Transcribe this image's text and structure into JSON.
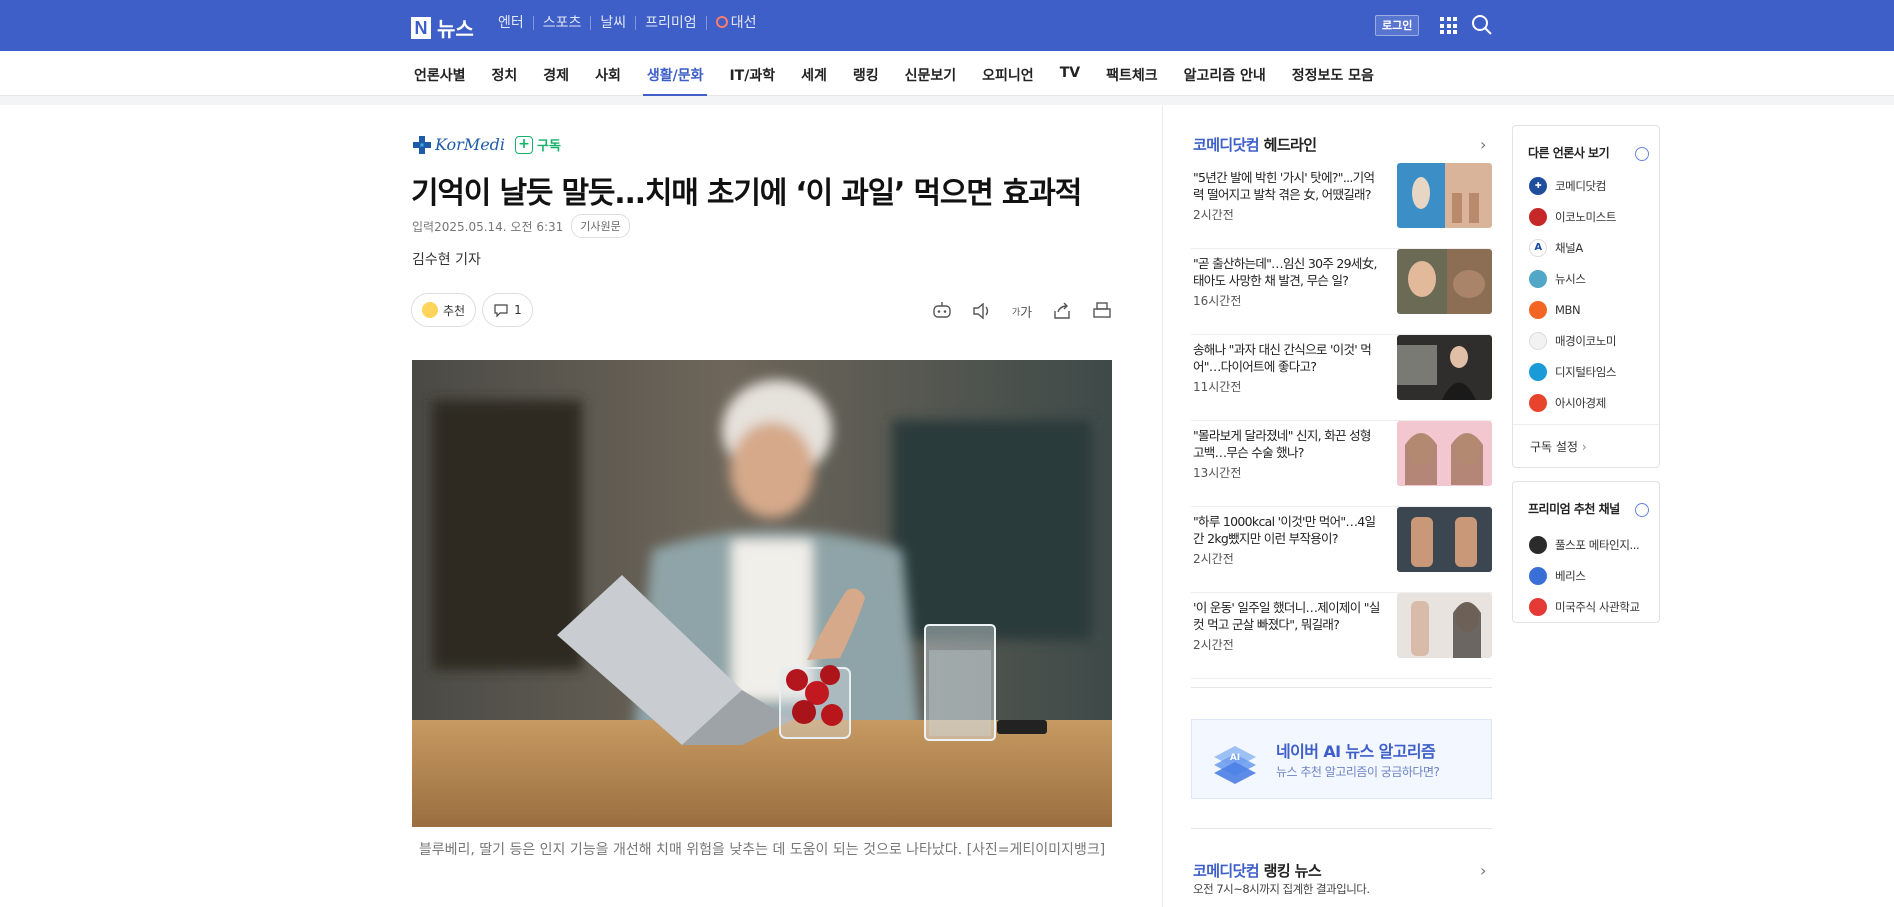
{
  "header": {
    "logo_text": "뉴스",
    "services": [
      "엔터",
      "스포츠",
      "날씨",
      "프리미엄",
      "대선"
    ],
    "login_label": "로그인"
  },
  "nav": {
    "items": [
      "언론사별",
      "정치",
      "경제",
      "사회",
      "생활/문화",
      "IT/과학",
      "세계",
      "랭킹",
      "신문보기",
      "오피니언",
      "TV",
      "팩트체크",
      "알고리즘 안내",
      "정정보도 모음"
    ],
    "active": "생활/문화"
  },
  "article": {
    "press_logo": "KorMedi",
    "subscribe_label": "구독",
    "title": "기억이 날듯 말듯...치매 초기에 ‘이 과일’ 먹으면 효과적",
    "date_label": "입력",
    "date": "2025.05.14. 오전 6:31",
    "original_label": "기사원문",
    "byline": "김수현 기자",
    "recommend_label": "추천",
    "comment_count": "1",
    "font_size_label": "가",
    "caption": "블루베리, 딸기 등은 인지 기능을 개선해 치매 위험을 낮추는 데 도움이 되는 것으로 나타났다. [사진=게티이미지뱅크]"
  },
  "headlines": {
    "press_name": "코메디닷컴",
    "title_suffix": "헤드라인",
    "items": [
      {
        "title": "\"5년간 발에 박힌 '가시' 탓에?\"...기억력 떨어지고 발착 겪은 女, 어땠길래?",
        "time": "2시간전"
      },
      {
        "title": "\"곧 출산하는데\"…임신 30주 29세女, 태아도 사망한 채 발견, 무슨 일?",
        "time": "16시간전"
      },
      {
        "title": "송해나 \"과자 대신 간식으로 '이것' 먹어\"…다이어트에 좋다고?",
        "time": "11시간전"
      },
      {
        "title": "\"몰라보게 달라졌네\" 신지, 화끈 성형 고백…무슨 수술 했나?",
        "time": "13시간전"
      },
      {
        "title": "\"하루 1000kcal '이것'만 먹어\"…4일간 2kg뺐지만 이런 부작용이?",
        "time": "2시간전"
      },
      {
        "title": "'이 운동' 일주일 했더니…제이제이 \"실컷 먹고 군살 빠졌다\", 뭐길래?",
        "time": "2시간전"
      }
    ]
  },
  "ai_promo": {
    "title": "네이버 AI 뉴스 알고리즘",
    "subtitle": "뉴스 추천 알고리즘이 궁금하다면?"
  },
  "ranking": {
    "press_name": "코메디닷컴",
    "title_suffix": "랭킹 뉴스",
    "subtitle": "오전 7시~8시까지 집계한 결과입니다."
  },
  "other_press": {
    "title": "다른 언론사 보기",
    "items": [
      {
        "name": "코메디닷컴",
        "color": "#1f4e9c",
        "mark": "✚"
      },
      {
        "name": "이코노미스트",
        "color": "#c62828",
        "mark": ""
      },
      {
        "name": "채널A",
        "color": "#ffffff",
        "mark": "A"
      },
      {
        "name": "뉴시스",
        "color": "#52a6c8",
        "mark": ""
      },
      {
        "name": "MBN",
        "color": "#f26522",
        "mark": ""
      },
      {
        "name": "매경이코노미",
        "color": "#f2f2f2",
        "mark": ""
      },
      {
        "name": "디지털타임스",
        "color": "#1a9ad6",
        "mark": ""
      },
      {
        "name": "아시아경제",
        "color": "#e8442d",
        "mark": ""
      }
    ],
    "setting_label": "구독 설정"
  },
  "premium": {
    "title": "프리미엄 추천 채널",
    "items": [
      {
        "name": "풀스포 메타인지...",
        "color": "#2b2b2b"
      },
      {
        "name": "베리스",
        "color": "#3a6fd8"
      },
      {
        "name": "미국주식 사관학교",
        "color": "#e53935"
      }
    ]
  }
}
